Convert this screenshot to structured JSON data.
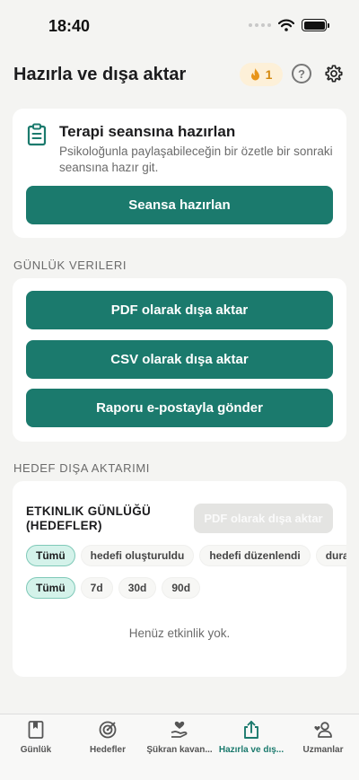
{
  "status_bar": {
    "time": "18:40"
  },
  "header": {
    "title": "Hazırla ve dışa aktar",
    "streak_count": "1"
  },
  "session_prep": {
    "title": "Terapi seansına hazırlan",
    "description": "Psikoloğunla paylaşabileceğin bir özetle bir sonraki seansına hazır git.",
    "button_label": "Seansa hazırlan"
  },
  "journal_data": {
    "section_label": "GÜNLÜK VERILERI",
    "pdf_button": "PDF olarak dışa aktar",
    "csv_button": "CSV olarak dışa aktar",
    "email_button": "Raporu e-postayla gönder"
  },
  "goal_export": {
    "section_label": "HEDEF DIŞA AKTARIMI",
    "log_title": "ETKINLIK GÜNLÜĞÜ (HEDEFLER)",
    "pdf_button": "PDF olarak dışa aktar",
    "event_filters": [
      "Tümü",
      "hedefi oluşturuldu",
      "hedefi düzenlendi",
      "durakl"
    ],
    "range_filters": [
      "Tümü",
      "7d",
      "30d",
      "90d"
    ],
    "empty_text": "Henüz etkinlik yok."
  },
  "tabbar": {
    "tabs": [
      {
        "label": "Günlük",
        "icon": "book-icon"
      },
      {
        "label": "Hedefler",
        "icon": "target-icon"
      },
      {
        "label": "Şükran kavan...",
        "icon": "heart-hand-icon"
      },
      {
        "label": "Hazırla ve dış...",
        "icon": "share-icon"
      },
      {
        "label": "Uzmanlar",
        "icon": "person-heart-icon"
      }
    ]
  },
  "colors": {
    "primary": "#1b7a6d",
    "chip_active_bg": "#d4f2ea",
    "streak_bg": "#fdf0d8",
    "streak_text": "#d4890f"
  }
}
